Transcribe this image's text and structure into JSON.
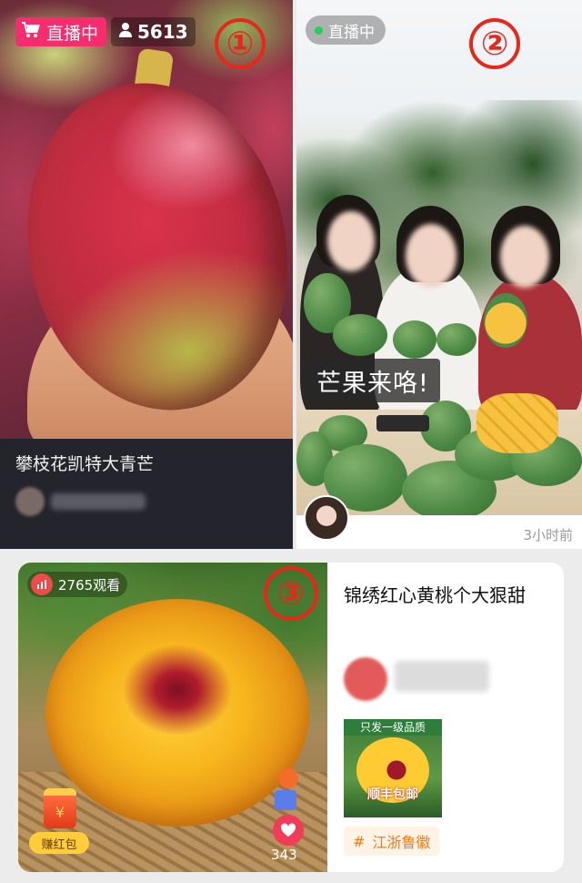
{
  "cards": [
    {
      "live_label": "直播中",
      "viewer_count": "5613",
      "number_mark": "①",
      "title": "攀枝花凯特大青芒"
    },
    {
      "live_label": "直播中",
      "number_mark": "②",
      "caption": "芒果来咯!",
      "time": "3小时前"
    },
    {
      "views": "2765观看",
      "number_mark": "③",
      "title": "锦绣红心黄桃个大狠甜",
      "thumbnail": {
        "headline": "只发一级品质",
        "footer": "顺丰包邮"
      },
      "red_packet_label": "赚红包",
      "red_packet_symbol": "¥",
      "like_count": "343",
      "tag": "江浙鲁徽",
      "tag_symbol": "#"
    }
  ],
  "colors": {
    "live_pink": "#f52c6e",
    "annotation_red": "#e8261a",
    "tag_orange": "#f07a1a",
    "live_green_dot": "#22d05a"
  },
  "icons": [
    "cart-icon",
    "person-icon",
    "live-dot-icon",
    "signal-bars-icon",
    "red-packet-icon",
    "heart-icon",
    "hash-icon"
  ]
}
